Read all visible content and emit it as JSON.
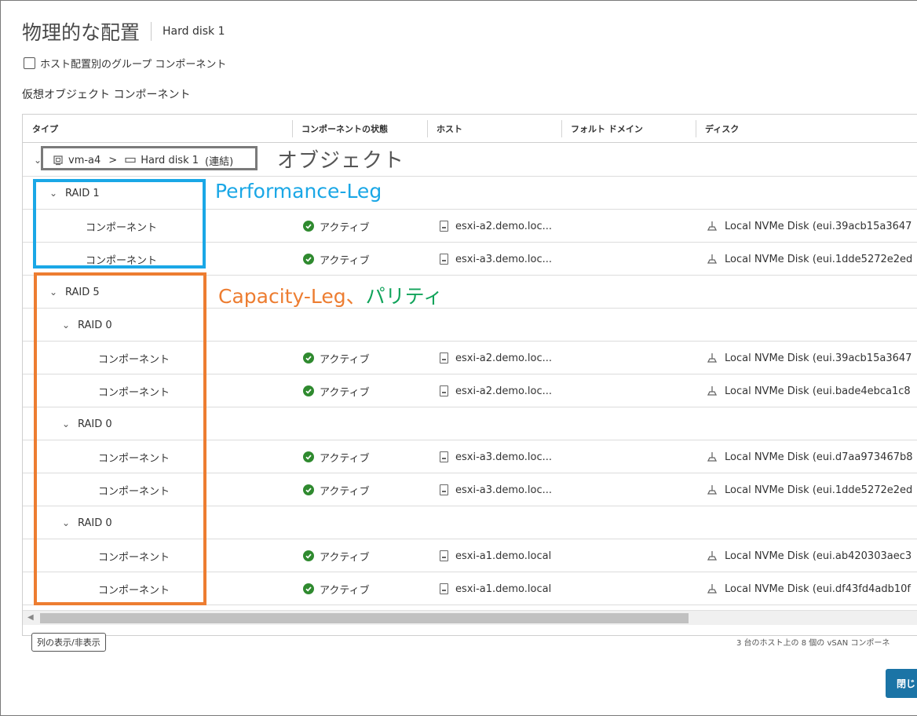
{
  "page": {
    "title": "物理的な配置",
    "subtitle": "Hard disk 1",
    "group_checkbox_label": "ホスト配置別のグループ コンポーネント",
    "section_label": "仮想オブジェクト コンポーネント"
  },
  "columns": [
    "タイプ",
    "コンポーネントの状態",
    "ホスト",
    "フォルト ドメイン",
    "ディスク"
  ],
  "object_row": {
    "vm": "vm-a4",
    "separator": ">",
    "disk": "Hard disk 1",
    "disk_suffix": "(連結)"
  },
  "rows": [
    {
      "type": "RAID 1",
      "indent": 1,
      "chevron": true
    },
    {
      "type": "コンポーネント",
      "indent": 2,
      "status": "アクティブ",
      "host": "esxi-a2.demo.loc...",
      "disk": "Local NVMe Disk (eui.39acb15a3647"
    },
    {
      "type": "コンポーネント",
      "indent": 2,
      "status": "アクティブ",
      "host": "esxi-a3.demo.loc...",
      "disk": "Local NVMe Disk (eui.1dde5272e2ed"
    },
    {
      "type": "RAID 5",
      "indent": 1,
      "chevron": true
    },
    {
      "type": "RAID 0",
      "indent": 2,
      "chevron": true
    },
    {
      "type": "コンポーネント",
      "indent": 3,
      "status": "アクティブ",
      "host": "esxi-a2.demo.loc...",
      "disk": "Local NVMe Disk (eui.39acb15a3647"
    },
    {
      "type": "コンポーネント",
      "indent": 3,
      "status": "アクティブ",
      "host": "esxi-a2.demo.loc...",
      "disk": "Local NVMe Disk (eui.bade4ebca1c8"
    },
    {
      "type": "RAID 0",
      "indent": 2,
      "chevron": true
    },
    {
      "type": "コンポーネント",
      "indent": 3,
      "status": "アクティブ",
      "host": "esxi-a3.demo.loc...",
      "disk": "Local NVMe Disk (eui.d7aa973467b8"
    },
    {
      "type": "コンポーネント",
      "indent": 3,
      "status": "アクティブ",
      "host": "esxi-a3.demo.loc...",
      "disk": "Local NVMe Disk (eui.1dde5272e2ed"
    },
    {
      "type": "RAID 0",
      "indent": 2,
      "chevron": true
    },
    {
      "type": "コンポーネント",
      "indent": 3,
      "status": "アクティブ",
      "host": "esxi-a1.demo.local",
      "disk": "Local NVMe Disk (eui.ab420303aec3"
    },
    {
      "type": "コンポーネント",
      "indent": 3,
      "status": "アクティブ",
      "host": "esxi-a1.demo.local",
      "disk": "Local NVMe Disk (eui.df43fd4adb10f"
    }
  ],
  "footer": {
    "columns_button": "列の表示/非表示",
    "summary": "3 台のホスト上の 8 個の vSAN コンポーネ"
  },
  "close_button": "閉じ",
  "annotations": {
    "object": "オブジェクト",
    "performance": "Performance-Leg",
    "capacity": "Capacity-Leg",
    "comma": "、",
    "parity": "パリティ"
  },
  "colors": {
    "status_green": "#2f8a2f",
    "primary_blue": "#1b74a6",
    "annotation_gray": "#555555",
    "annotation_cyan": "#1aa7e6",
    "annotation_orange": "#ed7d31",
    "annotation_green": "#10a35a"
  }
}
